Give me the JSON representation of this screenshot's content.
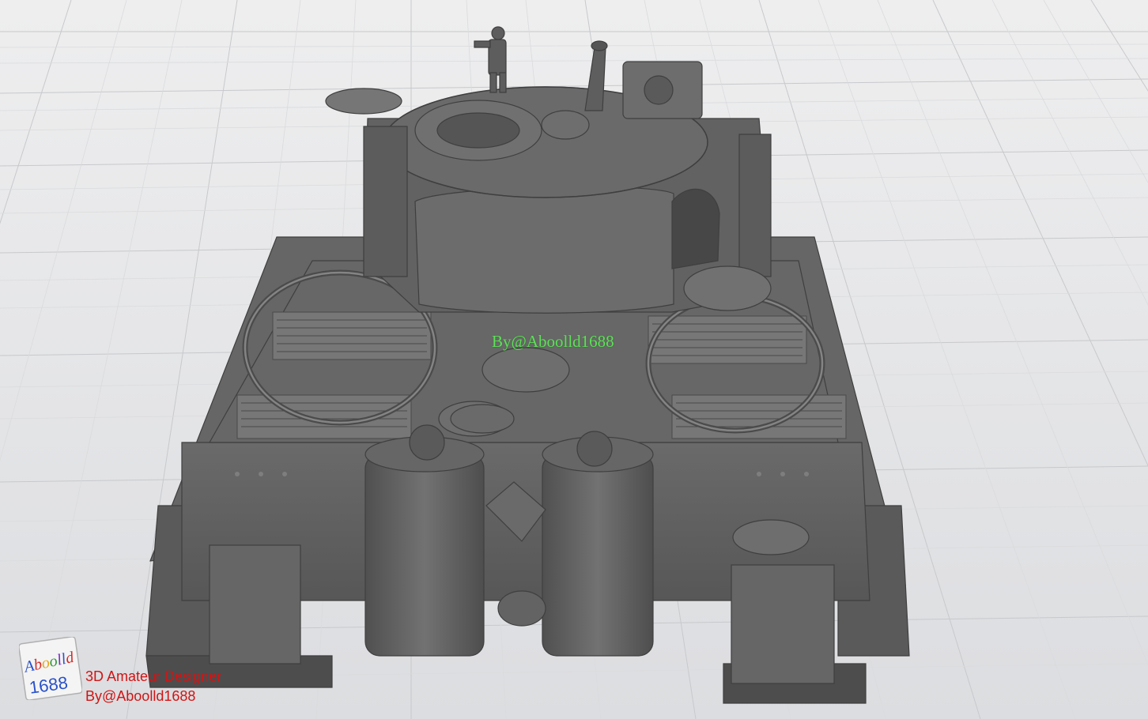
{
  "watermark": {
    "center_text": "By@Aboolld1688",
    "logo_text_top": "Aboolld",
    "logo_text_bottom": "1688"
  },
  "credits": {
    "line1": "3D Amateur Designer",
    "line2": "By@Aboolld1688"
  },
  "colors": {
    "background": "#e3e4e6",
    "grid": "#c9cacd",
    "model": "#5d5d5d",
    "watermark_green": "#5fe05a",
    "credit_red": "#d21414"
  },
  "subject_icon": "tiger-tank-3d-model"
}
